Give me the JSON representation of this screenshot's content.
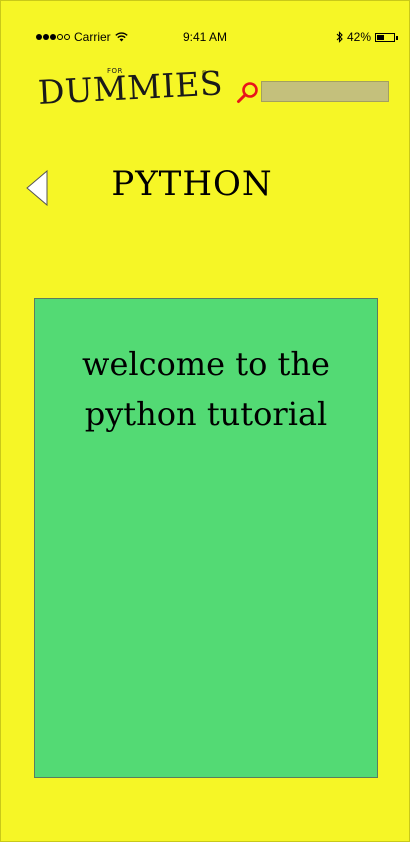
{
  "status_bar": {
    "carrier": "Carrier",
    "time": "9:41 AM",
    "battery": "42%",
    "battery_level": 0.42,
    "signal_bars_filled": 3,
    "signal_bars_total": 5,
    "icons": [
      "wifi-icon",
      "bluetooth-icon",
      "battery-icon"
    ]
  },
  "header": {
    "logo": {
      "for_text": "FOR",
      "word": "DUMMIES",
      "registered": "®"
    },
    "search": {
      "icon": "search-icon",
      "value": "",
      "placeholder": ""
    }
  },
  "title_row": {
    "back_icon": "back-arrow-icon",
    "title": "PYTHON"
  },
  "content": {
    "text": "welcome to the python tutorial"
  },
  "colors": {
    "background": "#f6f626",
    "card": "#53da74",
    "search_field": "#c4c07c",
    "search_icon": "#e8151b"
  }
}
